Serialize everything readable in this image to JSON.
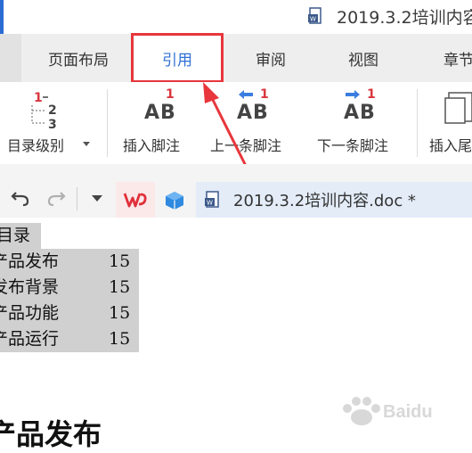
{
  "title": {
    "text": "2019.3.2培训内容"
  },
  "tabs": [
    {
      "label": "页面布局"
    },
    {
      "label": "引用",
      "active": true
    },
    {
      "label": "审阅"
    },
    {
      "label": "视图"
    },
    {
      "label": "章节"
    }
  ],
  "ribbon": {
    "toc_level": {
      "label": "目录级别",
      "icon_digits": [
        "1",
        "2",
        "3"
      ]
    },
    "insert_footnote": {
      "label": "插入脚注",
      "badge": "1",
      "glyph": "AB"
    },
    "prev_footnote": {
      "label": "上一条脚注",
      "badge": "1",
      "glyph": "AB"
    },
    "next_footnote": {
      "label": "下一条脚注",
      "badge": "1",
      "glyph": "AB"
    },
    "insert_endnote": {
      "label": "插入尾"
    }
  },
  "quick_access": {
    "doc_name": "2019.3.2培训内容.doc *"
  },
  "document": {
    "toc_title": "目录",
    "toc": [
      {
        "title": "产品发布",
        "page": "15"
      },
      {
        "title": "发布背景",
        "page": "15"
      },
      {
        "title": "产品功能",
        "page": "15"
      },
      {
        "title": "产品运行",
        "page": "15"
      }
    ],
    "heading": "产品发布"
  },
  "colors": {
    "accent_blue": "#2f6fd6",
    "highlight_red": "#e8363c",
    "toc_bg": "#d0d0d0"
  },
  "icons": [
    "doc-icon",
    "undo-icon",
    "redo-icon",
    "dropdown-icon",
    "wps-icon",
    "cube-icon",
    "arrow-left-icon",
    "arrow-right-icon",
    "chevron-down-icon"
  ]
}
